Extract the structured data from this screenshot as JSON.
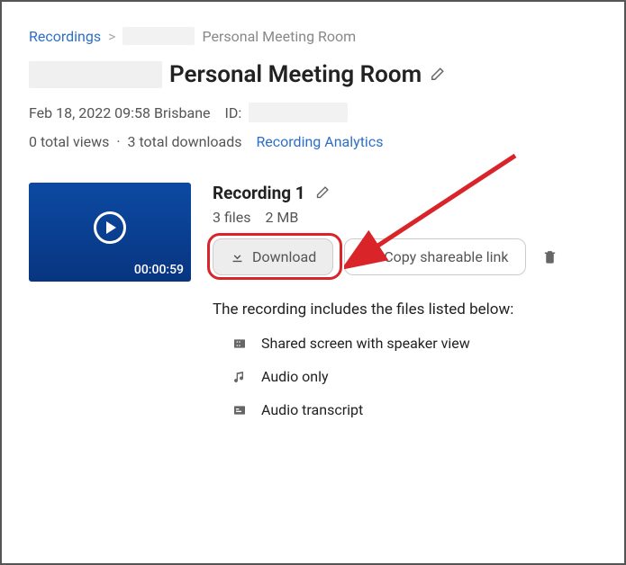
{
  "breadcrumb": {
    "root": "Recordings",
    "sep": ">",
    "current": "Personal Meeting Room"
  },
  "title": "Personal Meeting Room",
  "meta": {
    "datetime": "Feb 18, 2022 09:58 Brisbane",
    "id_label": "ID:"
  },
  "stats": {
    "views": "0 total views",
    "dot": "·",
    "downloads": "3 total downloads",
    "analytics": "Recording Analytics"
  },
  "recording": {
    "duration": "00:00:59",
    "title": "Recording 1",
    "file_count": "3 files",
    "size": "2 MB",
    "download_label": "Download",
    "copy_label": "Copy shareable link",
    "includes_label": "The recording includes the files listed below:",
    "files": {
      "a": "Shared screen with speaker view",
      "b": "Audio only",
      "c": "Audio transcript"
    }
  }
}
